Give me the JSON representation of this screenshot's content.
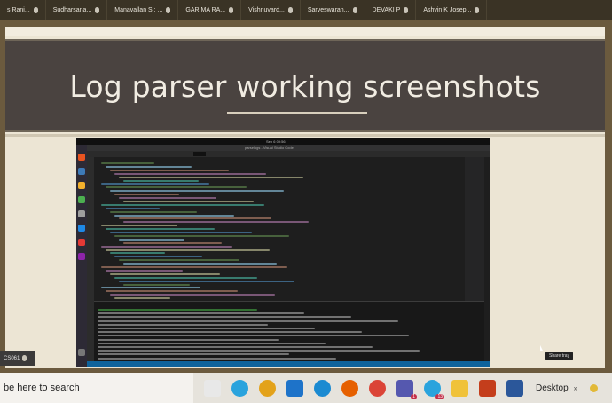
{
  "participants": [
    {
      "name": "s Rani..."
    },
    {
      "name": "Sudharsana..."
    },
    {
      "name": "Manavallan S : ..."
    },
    {
      "name": "GARIMA RA..."
    },
    {
      "name": "Vishnuvard..."
    },
    {
      "name": "Sarveswaran..."
    },
    {
      "name": "DEVAKI P"
    },
    {
      "name": "Ashvin K Josep..."
    }
  ],
  "slide": {
    "title": "Log parser working screenshots"
  },
  "embedded_screenshot": {
    "top_center_text": "Sep 6  09:56",
    "vs_title": "parselogs - Visual Studio Code"
  },
  "self_tile": {
    "name": "CS061"
  },
  "share_tooltip": "Share tray",
  "taskbar": {
    "search_placeholder": "be here to search",
    "desktop_label": "Desktop",
    "chevron": "»",
    "icons": [
      {
        "name": "calendar-icon",
        "color": "#e8e8e8"
      },
      {
        "name": "telegram-icon",
        "color": "#2aa3dd"
      },
      {
        "name": "chrome-icon",
        "color": "#e3a21a"
      },
      {
        "name": "mail-icon",
        "color": "#1e73c9"
      },
      {
        "name": "edge-icon",
        "color": "#1b8ad1"
      },
      {
        "name": "firefox-icon",
        "color": "#e66000"
      },
      {
        "name": "chrome-profile-icon",
        "color": "#db4437"
      },
      {
        "name": "teams-icon",
        "color": "#5558af",
        "badge": "1"
      },
      {
        "name": "telegram-desktop-icon",
        "color": "#2aa3dd",
        "badge": "13"
      },
      {
        "name": "file-explorer-icon",
        "color": "#f0c23a"
      },
      {
        "name": "powerpoint-icon",
        "color": "#c43e1c"
      },
      {
        "name": "word-icon",
        "color": "#2b579a"
      }
    ]
  }
}
